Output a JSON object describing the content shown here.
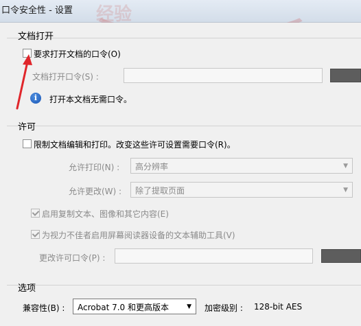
{
  "window": {
    "title": "口令安全性 - 设置"
  },
  "watermark": "经验",
  "open_section": {
    "title": "文档打开",
    "require_password_label": "要求打开文档的口令(O)",
    "require_password_checked": false,
    "password_label": "文档打开口令(S) :",
    "password_value": "",
    "info_text": "打开本文档无需口令。"
  },
  "permissions": {
    "title": "许可",
    "restrict_label": "限制文档编辑和打印。改变这些许可设置需要口令(R)。",
    "restrict_checked": false,
    "print_label": "允许打印(N) :",
    "print_value": "高分辨率",
    "change_label": "允许更改(W) :",
    "change_value": "除了提取页面",
    "copy_label": "启用复制文本、图像和其它内容(E)",
    "copy_checked": true,
    "accessibility_label": "为视力不佳者启用屏幕阅读器设备的文本辅助工具(V)",
    "accessibility_checked": true,
    "perm_password_label": "更改许可口令(P) :",
    "perm_password_value": ""
  },
  "options": {
    "title": "选项",
    "compat_label": "兼容性(B) :",
    "compat_value": "Acrobat 7.0 和更高版本",
    "encrypt_label": "加密级别 :",
    "encrypt_value": "128-bit AES"
  },
  "colors": {
    "annotation_arrow": "#e0262b",
    "info_icon": "#1a56b5"
  }
}
